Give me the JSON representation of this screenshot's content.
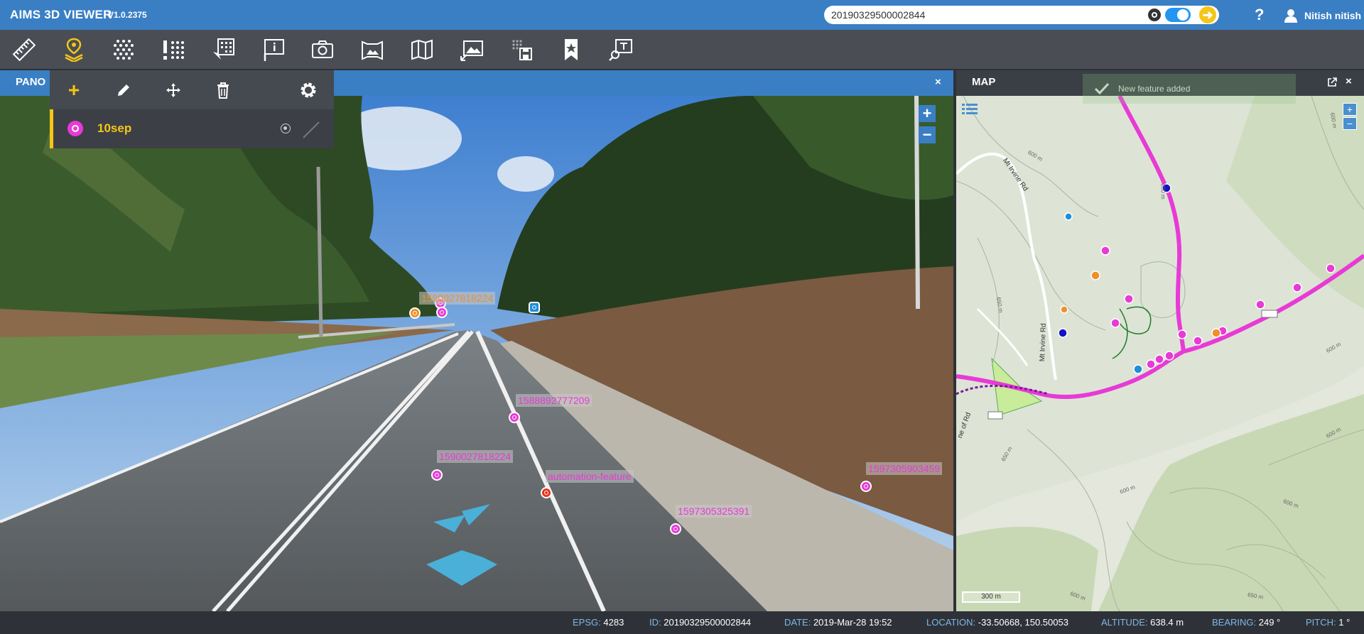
{
  "app": {
    "title": "AIMS 3D VIEWER",
    "version": "V1.0.2375"
  },
  "search": {
    "value": "20190329500002844"
  },
  "user": {
    "name": "Nitish nitish"
  },
  "toolbar": {
    "tools": [
      "ruler-icon",
      "feature-layer-icon",
      "points-grid-icon",
      "issues-icon",
      "grid-select-icon",
      "info-sign-icon",
      "camera-icon",
      "image-frame-icon",
      "map-fold-icon",
      "image-upload-icon",
      "save-grid-icon",
      "bookmark-star-icon",
      "search-sign-icon"
    ],
    "status_user": "nitish",
    "status_color": "#f5c518"
  },
  "panorama": {
    "tab_label": "PANO",
    "close": "×",
    "labels": [
      {
        "text": "1590027818224"
      },
      {
        "text": "1588892777209"
      },
      {
        "text": "1590027818224"
      },
      {
        "text": "automation-feature"
      },
      {
        "text": "1597305325391"
      },
      {
        "text": "1597305903459"
      }
    ],
    "zoom_in": "+",
    "zoom_out": "−"
  },
  "feature_panel": {
    "add_label": "+",
    "layer_name": "10sep",
    "accent": "#f5c518"
  },
  "map": {
    "title": "MAP",
    "close": "×",
    "zoom_in": "+",
    "zoom_out": "−",
    "scale": "300 m",
    "road_labels": [
      "Mt Irvine Rd",
      "Mt Irvine Rd",
      "ne of Rd"
    ],
    "contour_labels": [
      "600 m",
      "600 m",
      "650 m",
      "600 m",
      "650 m",
      "600 m",
      "600 m",
      "600 m",
      "650 m",
      "600 m",
      "600 m"
    ],
    "route_color": "#e83ad6"
  },
  "notification": {
    "text": "New feature added"
  },
  "statusbar": {
    "epsg_key": "EPSG:",
    "epsg": "4283",
    "id_key": "ID:",
    "id": "20190329500002844",
    "date_key": "DATE:",
    "date": "2019-Mar-28 19:52",
    "location_key": "LOCATION:",
    "location": "-33.50668, 150.50053",
    "altitude_key": "ALTITUDE:",
    "altitude": "638.4 m",
    "bearing_key": "BEARING:",
    "bearing": "249 °",
    "pitch_key": "PITCH:",
    "pitch": "1 °"
  }
}
